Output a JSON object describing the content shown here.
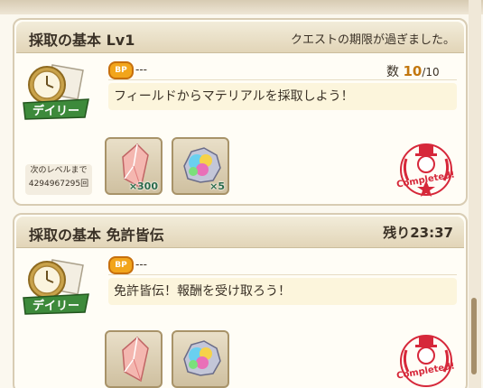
{
  "quests": [
    {
      "title": "採取の基本 Lv1",
      "status": "クエストの期限が過ぎました。",
      "badge": "デイリー",
      "bp_icon": "BP",
      "bp_value": "---",
      "count_label": "数",
      "count_current": "10",
      "count_max": "/10",
      "description": "フィールドからマテリアルを採取しよう！",
      "next_level_label": "次のレベルまで",
      "next_level_value": "4294967295回",
      "rewards": [
        {
          "icon": "crystal-shard-icon",
          "qty": "×300"
        },
        {
          "icon": "rainbow-ore-icon",
          "qty": "×5"
        }
      ],
      "stamp": "Completed!"
    },
    {
      "title": "採取の基本 免許皆伝",
      "timer": "残り23:37",
      "badge": "デイリー",
      "bp_icon": "BP",
      "bp_value": "---",
      "description": "免許皆伝！報酬を受け取ろう！",
      "rewards": [
        {
          "icon": "crystal-shard-icon"
        },
        {
          "icon": "rainbow-ore-icon"
        }
      ],
      "stamp": "Completed!"
    }
  ]
}
